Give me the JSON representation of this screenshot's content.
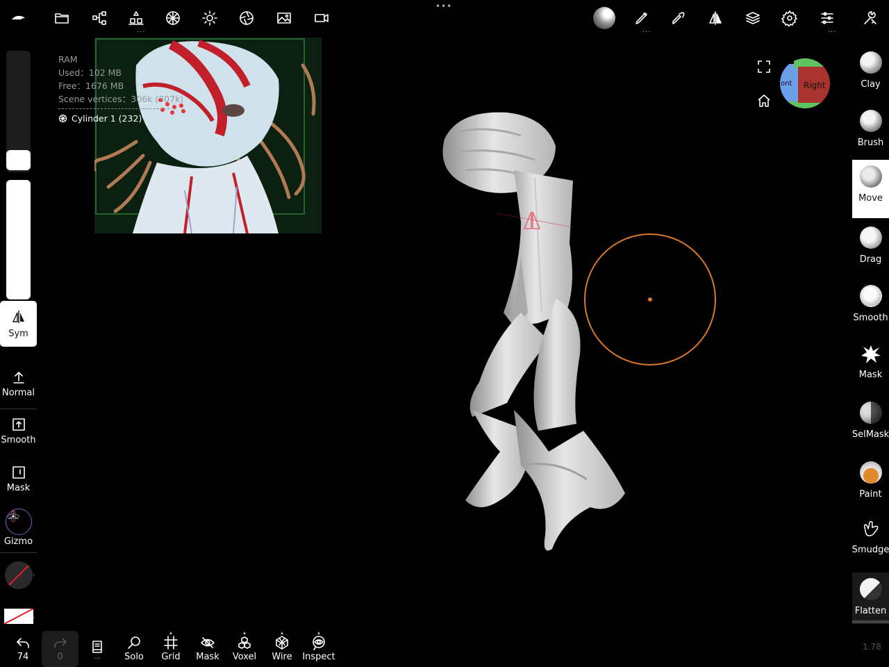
{
  "top_dots": "•••",
  "toolbar_more": "...",
  "info": {
    "ram_label": "RAM",
    "used": "Used：102 MB",
    "free": "Free：1676 MB",
    "vertices": "Scene vertices：306k (307k)",
    "object": "Cylinder 1 (232)"
  },
  "viewcube": {
    "front": "ont",
    "right": "Right"
  },
  "left_tools": {
    "sym": "Sym",
    "normal": "Normal",
    "smooth": "Smooth",
    "mask": "Mask",
    "gizmo": "Gizmo"
  },
  "brushes": [
    {
      "label": "Clay"
    },
    {
      "label": "Brush"
    },
    {
      "label": "Move"
    },
    {
      "label": "Drag"
    },
    {
      "label": "Smooth"
    },
    {
      "label": "Mask"
    },
    {
      "label": "SelMask"
    },
    {
      "label": "Paint"
    },
    {
      "label": "Smudge"
    },
    {
      "label": "Flatten"
    }
  ],
  "bottom": {
    "undo_count": "74",
    "redo_count": "0",
    "more": "...",
    "solo": "Solo",
    "grid": "Grid",
    "mask": "Mask",
    "voxel": "Voxel",
    "wire": "Wire",
    "inspect": "Inspect"
  },
  "version": "1.78",
  "colors": {
    "accent_orange": "#d9792a",
    "viewcube_red": "#a8332f",
    "viewcube_blue": "#6aa0e8",
    "viewcube_green": "#5fc45f"
  }
}
